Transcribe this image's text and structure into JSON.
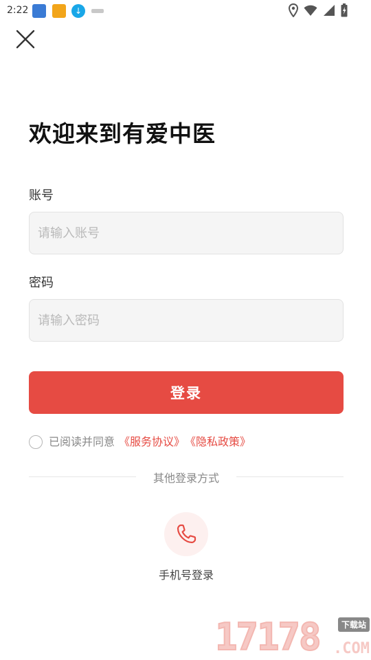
{
  "status_bar": {
    "time": "2:22",
    "icons": [
      "notification-app-icon",
      "notification-app-icon",
      "download-icon",
      "notification-app-icon",
      "location-icon",
      "wifi-icon",
      "signal-icon",
      "battery-icon"
    ]
  },
  "header": {
    "close_icon": "close-icon"
  },
  "main": {
    "title": "欢迎来到有爱中医",
    "account_label": "账号",
    "account_placeholder": "请输入账号",
    "account_value": "",
    "password_label": "密码",
    "password_placeholder": "请输入密码",
    "password_value": "",
    "login_button": "登录"
  },
  "agreement": {
    "checked": false,
    "prefix": "已阅读并同意",
    "service_link": "《服务协议》",
    "privacy_link": "《隐私政策》"
  },
  "other_login": {
    "divider_text": "其他登录方式",
    "phone_icon": "phone-icon",
    "phone_label": "手机号登录"
  },
  "colors": {
    "accent": "#e64b43",
    "input_bg": "#f5f5f5",
    "phone_circle_bg": "#fdf0ef"
  },
  "watermark": {
    "digits": "17178",
    "domain": ".COM",
    "badge": "下载站"
  }
}
